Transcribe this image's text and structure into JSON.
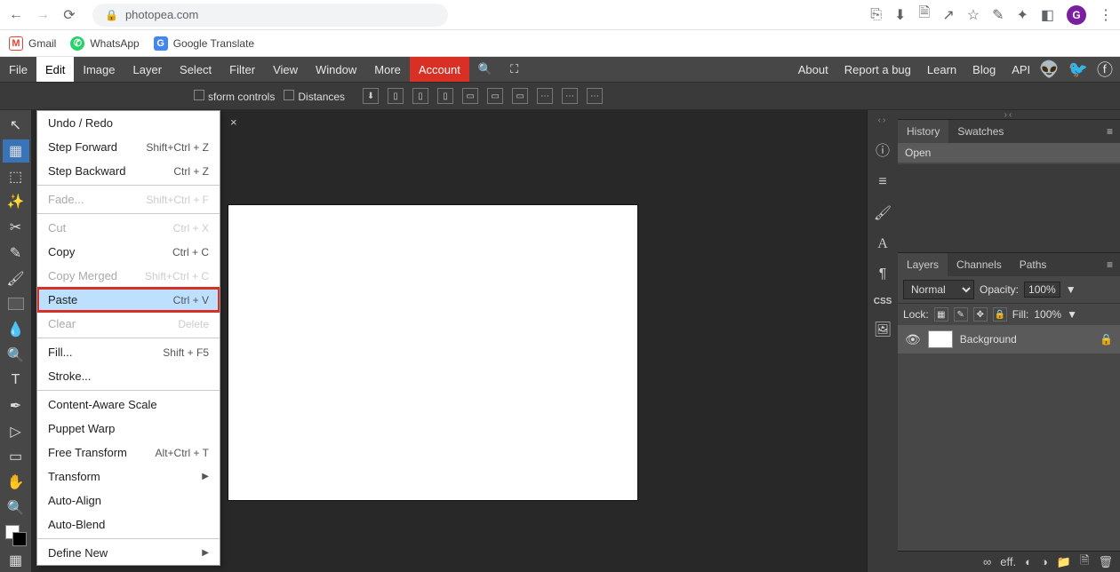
{
  "browser": {
    "url": "photopea.com",
    "avatar_letter": "G",
    "bookmarks": [
      {
        "label": "Gmail"
      },
      {
        "label": "WhatsApp"
      },
      {
        "label": "Google Translate"
      }
    ]
  },
  "menubar": {
    "items": [
      "File",
      "Edit",
      "Image",
      "Layer",
      "Select",
      "Filter",
      "View",
      "Window",
      "More"
    ],
    "account": "Account",
    "right": [
      "About",
      "Report a bug",
      "Learn",
      "Blog",
      "API"
    ]
  },
  "options_bar": {
    "transform_label": "sform controls",
    "distances_label": "Distances"
  },
  "edit_menu": {
    "items": [
      {
        "label": "Undo / Redo",
        "shortcut": "",
        "disabled": false
      },
      {
        "label": "Step Forward",
        "shortcut": "Shift+Ctrl + Z",
        "disabled": false
      },
      {
        "label": "Step Backward",
        "shortcut": "Ctrl + Z",
        "disabled": false
      },
      {
        "sep": true
      },
      {
        "label": "Fade...",
        "shortcut": "Shift+Ctrl + F",
        "disabled": true
      },
      {
        "sep": true
      },
      {
        "label": "Cut",
        "shortcut": "Ctrl + X",
        "disabled": true
      },
      {
        "label": "Copy",
        "shortcut": "Ctrl + C",
        "disabled": false
      },
      {
        "label": "Copy Merged",
        "shortcut": "Shift+Ctrl + C",
        "disabled": true
      },
      {
        "label": "Paste",
        "shortcut": "Ctrl + V",
        "disabled": false,
        "highlight": true
      },
      {
        "label": "Clear",
        "shortcut": "Delete",
        "disabled": true
      },
      {
        "sep": true
      },
      {
        "label": "Fill...",
        "shortcut": "Shift + F5",
        "disabled": false
      },
      {
        "label": "Stroke...",
        "shortcut": "",
        "disabled": false
      },
      {
        "sep": true
      },
      {
        "label": "Content-Aware Scale",
        "shortcut": "",
        "disabled": false
      },
      {
        "label": "Puppet Warp",
        "shortcut": "",
        "disabled": false
      },
      {
        "label": "Free Transform",
        "shortcut": "Alt+Ctrl + T",
        "disabled": false
      },
      {
        "label": "Transform",
        "shortcut": "",
        "disabled": false,
        "submenu": true
      },
      {
        "label": "Auto-Align",
        "shortcut": "",
        "disabled": false
      },
      {
        "label": "Auto-Blend",
        "shortcut": "",
        "disabled": false
      },
      {
        "sep": true
      },
      {
        "label": "Define New",
        "shortcut": "",
        "disabled": false,
        "submenu": true
      }
    ]
  },
  "document_tab": {
    "close": "×"
  },
  "panels": {
    "history": {
      "tabs": [
        "History",
        "Swatches"
      ],
      "entry": "Open"
    },
    "layers": {
      "tabs": [
        "Layers",
        "Channels",
        "Paths"
      ],
      "blend_mode": "Normal",
      "opacity_label": "Opacity:",
      "opacity_value": "100%",
      "lock_label": "Lock:",
      "fill_label": "Fill:",
      "fill_value": "100%",
      "layer_name": "Background",
      "footer_eff": "eff."
    }
  }
}
